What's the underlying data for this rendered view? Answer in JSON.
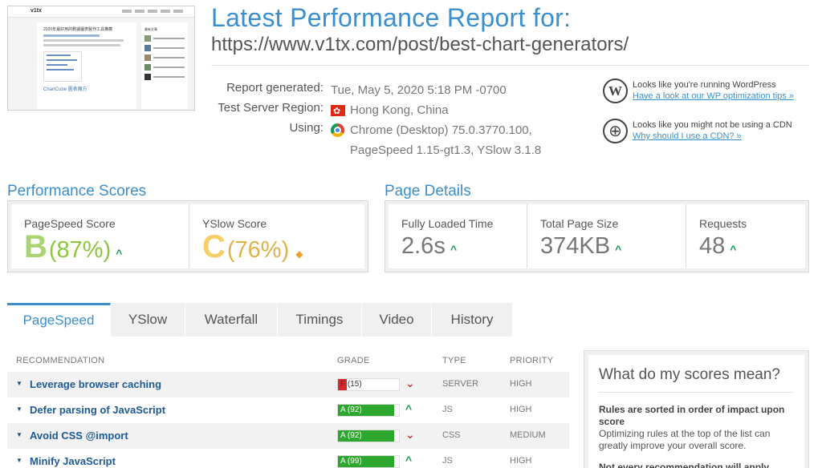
{
  "thumbnail": {
    "site_logo": "v1tx",
    "headline": "2020年最好用的數據圖表製作工具推薦",
    "cta_text": "ChartCube 圖表魔方",
    "sidebar_title": "最新文章"
  },
  "header": {
    "title": "Latest Performance Report for:",
    "url": "https://www.v1tx.com/post/best-chart-generators/"
  },
  "report": {
    "generated_label": "Report generated:",
    "generated_value": "Tue, May 5, 2020 5:18 PM -0700",
    "region_label": "Test Server Region:",
    "region_value": "Hong Kong, China",
    "using_label": "Using:",
    "using_value_1": "Chrome (Desktop) 75.0.3770.100,",
    "using_value_2": "PageSpeed 1.15-gt1.3, YSlow 3.1.8"
  },
  "tips": [
    {
      "icon": "wordpress-icon",
      "text": "Looks like you're running WordPress",
      "link": "Have a look at our WP optimization tips »"
    },
    {
      "icon": "globe-icon",
      "text": "Looks like you might not be using a CDN",
      "link": "Why should I use a CDN? »"
    }
  ],
  "performance_scores": {
    "title": "Performance Scores",
    "pagespeed": {
      "label": "PageSpeed Score",
      "grade": "B",
      "percent": "(87%)"
    },
    "yslow": {
      "label": "YSlow Score",
      "grade": "C",
      "percent": "(76%)"
    }
  },
  "page_details": {
    "title": "Page Details",
    "loaded": {
      "label": "Fully Loaded Time",
      "value": "2.6s"
    },
    "size": {
      "label": "Total Page Size",
      "value": "374KB"
    },
    "requests": {
      "label": "Requests",
      "value": "48"
    }
  },
  "tabs": [
    "PageSpeed",
    "YSlow",
    "Waterfall",
    "Timings",
    "Video",
    "History"
  ],
  "table": {
    "headers": {
      "recommendation": "RECOMMENDATION",
      "grade": "GRADE",
      "type": "TYPE",
      "priority": "PRIORITY"
    },
    "rows": [
      {
        "name": "Leverage browser caching",
        "grade": "F (15)",
        "score": 15,
        "color": "#d9262c",
        "trend": "down",
        "type": "SERVER",
        "priority": "HIGH"
      },
      {
        "name": "Defer parsing of JavaScript",
        "grade": "A (92)",
        "score": 92,
        "color": "#2ea72e",
        "trend": "up",
        "type": "JS",
        "priority": "HIGH"
      },
      {
        "name": "Avoid CSS @import",
        "grade": "A (92)",
        "score": 92,
        "color": "#2ea72e",
        "trend": "down",
        "type": "CSS",
        "priority": "MEDIUM"
      },
      {
        "name": "Minify JavaScript",
        "grade": "A (99)",
        "score": 99,
        "color": "#2ea72e",
        "trend": "up",
        "type": "JS",
        "priority": "HIGH"
      }
    ]
  },
  "sidebox": {
    "title": "What do my scores mean?",
    "bold1": "Rules are sorted in order of impact upon score",
    "text1": "Optimizing rules at the top of the list can greatly improve your overall score.",
    "bold2": "Not every recommendation will apply"
  },
  "colors": {
    "accent": "#3c8fcf",
    "grade_b": "#8dc63f",
    "grade_c": "#f5c342",
    "fail": "#d9262c",
    "pass": "#2ea72e"
  }
}
